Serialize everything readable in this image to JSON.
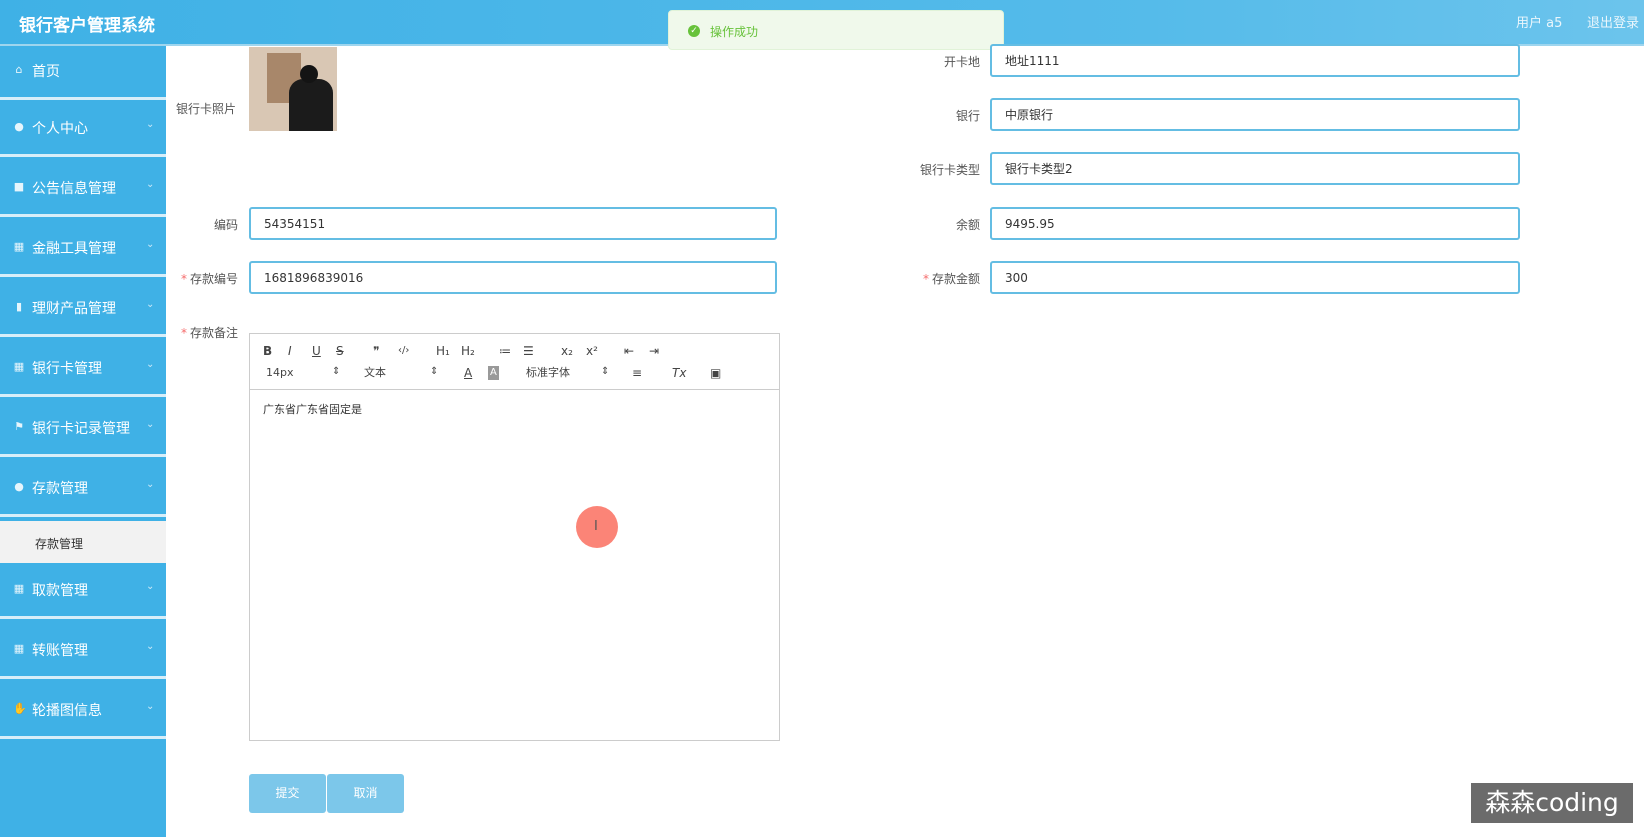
{
  "app": {
    "title": "银行客户管理系统"
  },
  "header": {
    "user_label": "用户 a5",
    "logout_label": "退出登录"
  },
  "toast": {
    "message": "操作成功",
    "status_color": "#67c23a"
  },
  "sidebar": {
    "accent_color": "#3fb1e6",
    "items": [
      {
        "label": "首页",
        "icon": "home-icon"
      },
      {
        "label": "个人中心",
        "icon": "user-icon"
      },
      {
        "label": "公告信息管理",
        "icon": "notice-icon"
      },
      {
        "label": "金融工具管理",
        "icon": "grid-icon"
      },
      {
        "label": "理财产品管理",
        "icon": "bar-chart-icon"
      },
      {
        "label": "银行卡管理",
        "icon": "grid-icon"
      },
      {
        "label": "银行卡记录管理",
        "icon": "flag-icon"
      },
      {
        "label": "存款管理",
        "icon": "user-icon"
      },
      {
        "label": "取款管理",
        "icon": "grid-icon"
      },
      {
        "label": "转账管理",
        "icon": "grid-icon"
      },
      {
        "label": "轮播图信息",
        "icon": "thumb-icon"
      }
    ],
    "sub_item": {
      "label": "存款管理"
    }
  },
  "form": {
    "photo_label": "银行卡照片",
    "card_location": {
      "label": "开卡地",
      "value": "地址1111"
    },
    "bank": {
      "label": "银行",
      "value": "中原银行"
    },
    "card_type": {
      "label": "银行卡类型",
      "value": "银行卡类型2"
    },
    "code": {
      "label": "编码",
      "value": "54354151"
    },
    "balance": {
      "label": "余额",
      "value": "9495.95"
    },
    "deposit_no": {
      "label": "存款编号",
      "value": "1681896839016",
      "required_mark": "*"
    },
    "deposit_amount": {
      "label": "存款金额",
      "value": "300",
      "required_mark": "*"
    },
    "remark": {
      "label": "存款备注",
      "required_mark": "*",
      "content": "广东省广东省固定是"
    },
    "editor_toolbar": {
      "bold": "B",
      "italic": "I",
      "underline": "U",
      "strike": "S",
      "quote": "❞",
      "code": "‹/›",
      "h1": "H₁",
      "h2": "H₂",
      "ordered_list": "≔",
      "bullet_list": "☰",
      "subscript": "x₂",
      "superscript": "x²",
      "outdent": "⇤",
      "indent": "⇥",
      "font_size": "14px",
      "header_select": "文本",
      "font_family": "标准字体",
      "color": "A",
      "bg_color": "A",
      "align": "≡",
      "clean": "Tx",
      "image": "▣"
    },
    "submit_label": "提交",
    "cancel_label": "取消"
  },
  "watermark": "森森coding"
}
